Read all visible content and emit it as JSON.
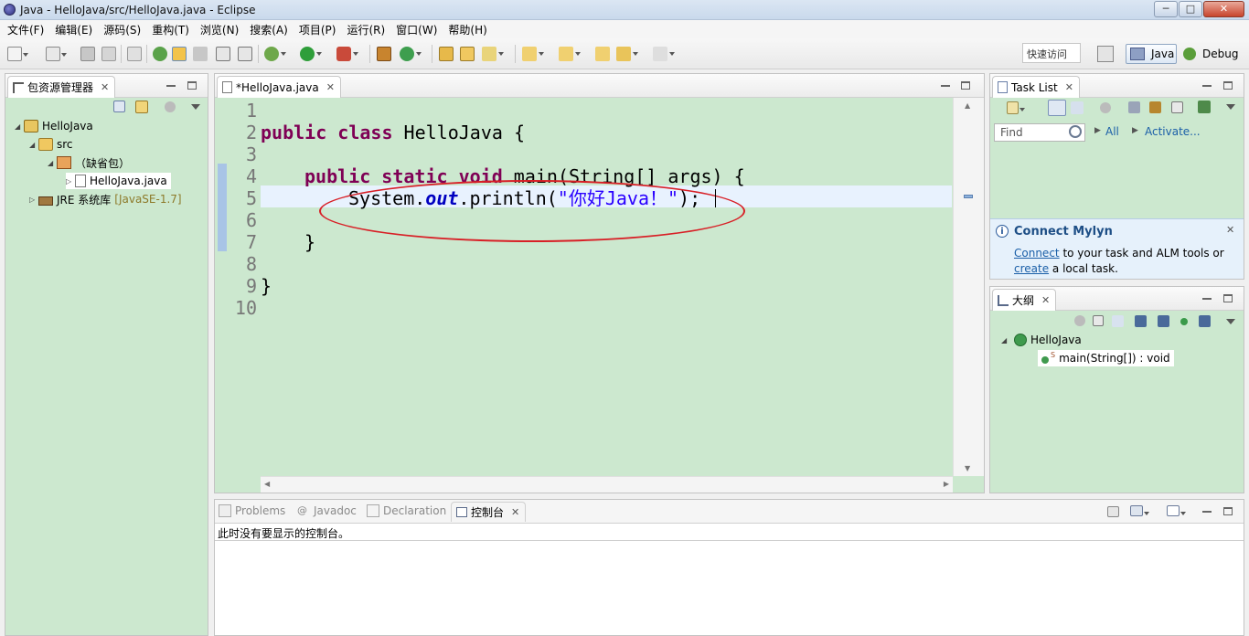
{
  "window": {
    "title": "Java - HelloJava/src/HelloJava.java - Eclipse",
    "controls": {
      "minimize": "─",
      "maximize": "□",
      "close": "✕"
    }
  },
  "menubar": {
    "items": [
      "文件(F)",
      "编辑(E)",
      "源码(S)",
      "重构(T)",
      "浏览(N)",
      "搜索(A)",
      "项目(P)",
      "运行(R)",
      "窗口(W)",
      "帮助(H)"
    ]
  },
  "toolbar": {
    "quick_access_placeholder": "快速访问",
    "perspectives": [
      {
        "label": "Java",
        "active": true
      },
      {
        "label": "Debug",
        "active": false
      }
    ]
  },
  "package_explorer": {
    "tab_label": "包资源管理器",
    "tree": [
      {
        "label": "HelloJava",
        "icon": "java-project-icon",
        "level": 0,
        "expanded": true
      },
      {
        "label": "src",
        "icon": "source-folder-icon",
        "level": 1,
        "expanded": true
      },
      {
        "label": "（缺省包）",
        "icon": "package-icon",
        "level": 2,
        "expanded": true
      },
      {
        "label": "HelloJava.java",
        "icon": "java-file-icon",
        "level": 3,
        "expanded": false
      },
      {
        "label": "JRE 系统库",
        "suffix": "[JavaSE-1.7]",
        "icon": "library-icon",
        "level": 1,
        "expanded": false
      }
    ]
  },
  "editor": {
    "tab_label": "*HelloJava.java",
    "line_numbers": [
      "1",
      "2",
      "3",
      "4",
      "5",
      "6",
      "7",
      "8",
      "9",
      "10"
    ],
    "code": {
      "l2_kw1": "public",
      "l2_kw2": "class",
      "l2_rest": " HelloJava {",
      "l4_kw1": "public",
      "l4_kw2": "static",
      "l4_kw3": "void",
      "l4_rest": " main(String[] args) {",
      "l5_pre": "System.",
      "l5_field": "out",
      "l5_mid": ".println(",
      "l5_str": "\"你好Java！\"",
      "l5_end": ");",
      "l7": "}",
      "l9": "}"
    }
  },
  "task_list": {
    "tab_label": "Task List",
    "find_placeholder": "Find",
    "all_link": "All",
    "activate_link": "Activate...",
    "mylyn": {
      "title": "Connect Mylyn",
      "connect_link": "Connect",
      "text1": " to your task and ALM tools or",
      "create_link": "create",
      "text2": " a local task."
    }
  },
  "outline": {
    "tab_label": "大纲",
    "class_name": "HelloJava",
    "method": "main(String[]) : void",
    "method_modifier": "S"
  },
  "console": {
    "tabs": [
      "Problems",
      "Javadoc",
      "Declaration",
      "控制台"
    ],
    "active_tab": "控制台",
    "message": "此时没有要显示的控制台。"
  },
  "colors": {
    "editor_bg": "#cce8cf",
    "keyword": "#7f0055",
    "string": "#2a00ff",
    "field": "#0000c0",
    "annotation": "#d81f26"
  }
}
